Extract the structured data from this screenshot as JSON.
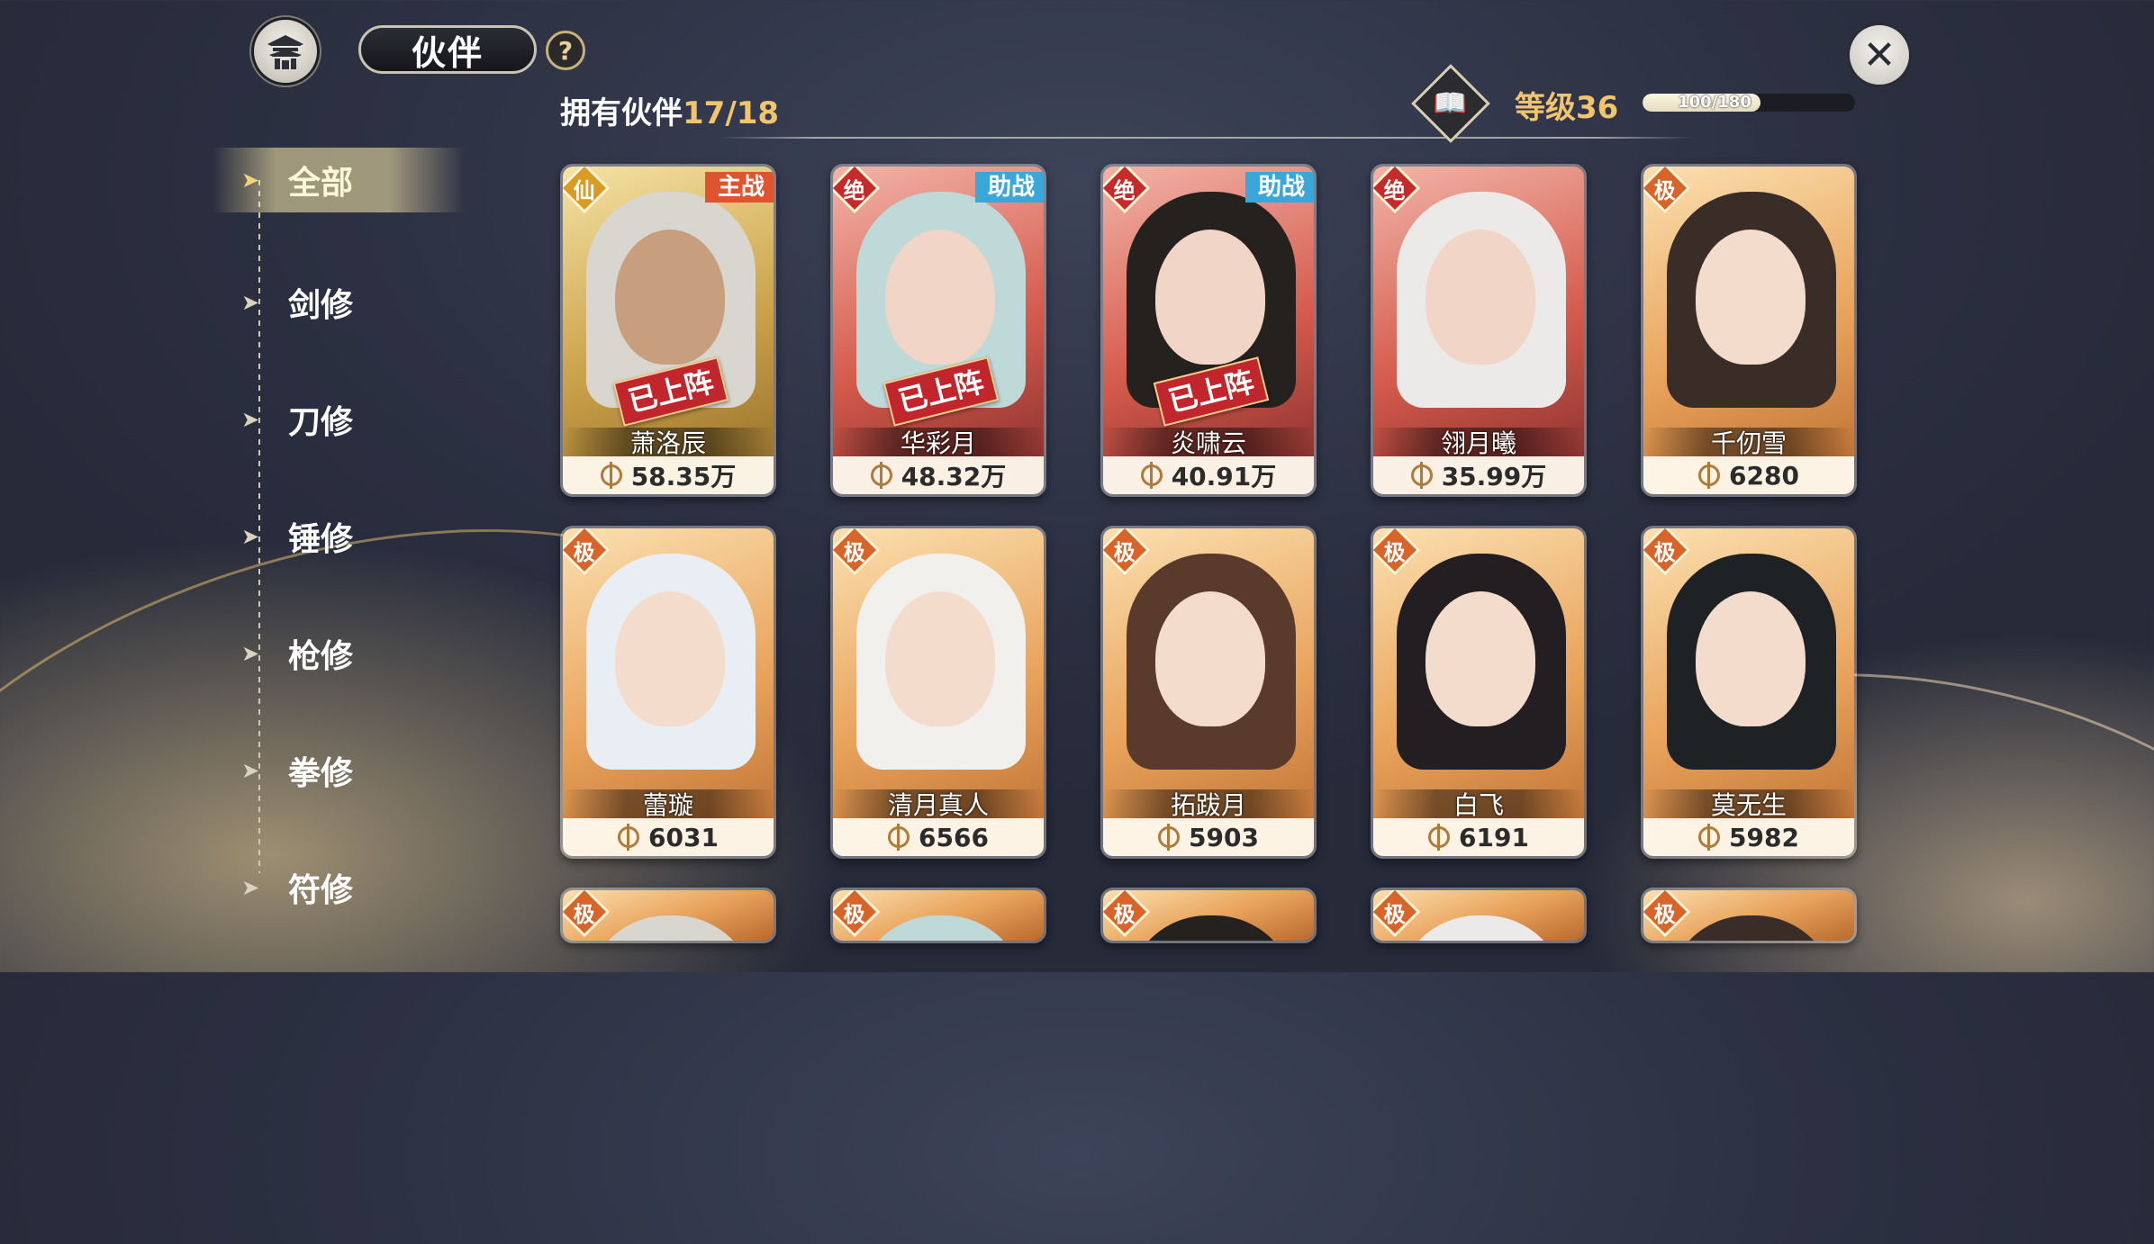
{
  "header": {
    "title": "伙伴",
    "help_label": "?",
    "owned_label": "拥有伙伴",
    "owned_count": "17/18",
    "level_label": "等级36",
    "xp_text": "100/180",
    "xp_fraction": 0.5556
  },
  "sidebar": {
    "items": [
      {
        "label": "全部",
        "active": true
      },
      {
        "label": "剑修",
        "active": false
      },
      {
        "label": "刀修",
        "active": false
      },
      {
        "label": "锤修",
        "active": false
      },
      {
        "label": "枪修",
        "active": false
      },
      {
        "label": "拳修",
        "active": false
      },
      {
        "label": "符修",
        "active": false
      }
    ]
  },
  "cards": [
    {
      "name": "萧洛辰",
      "power": "58.35万",
      "rank": "仙",
      "role": "主战",
      "deployed": "已上阵",
      "theme": "gold"
    },
    {
      "name": "华彩月",
      "power": "48.32万",
      "rank": "绝",
      "role": "助战",
      "deployed": "已上阵",
      "theme": "red"
    },
    {
      "name": "炎啸云",
      "power": "40.91万",
      "rank": "绝",
      "role": "助战",
      "deployed": "已上阵",
      "theme": "red"
    },
    {
      "name": "翎月曦",
      "power": "35.99万",
      "rank": "绝",
      "role": "",
      "deployed": "",
      "theme": "red"
    },
    {
      "name": "千仞雪",
      "power": "6280",
      "rank": "极",
      "role": "",
      "deployed": "",
      "theme": "orange"
    },
    {
      "name": "蕾璇",
      "power": "6031",
      "rank": "极",
      "role": "",
      "deployed": "",
      "theme": "orange"
    },
    {
      "name": "清月真人",
      "power": "6566",
      "rank": "极",
      "role": "",
      "deployed": "",
      "theme": "orange"
    },
    {
      "name": "拓跋月",
      "power": "5903",
      "rank": "极",
      "role": "",
      "deployed": "",
      "theme": "orange"
    },
    {
      "name": "白飞",
      "power": "6191",
      "rank": "极",
      "role": "",
      "deployed": "",
      "theme": "orange"
    },
    {
      "name": "莫无生",
      "power": "5982",
      "rank": "极",
      "role": "",
      "deployed": "",
      "theme": "orange"
    },
    {
      "name": "",
      "power": "",
      "rank": "极",
      "role": "",
      "deployed": "",
      "theme": "orange"
    },
    {
      "name": "",
      "power": "",
      "rank": "极",
      "role": "",
      "deployed": "",
      "theme": "orange"
    },
    {
      "name": "",
      "power": "",
      "rank": "极",
      "role": "",
      "deployed": "",
      "theme": "orange"
    },
    {
      "name": "",
      "power": "",
      "rank": "极",
      "role": "",
      "deployed": "",
      "theme": "orange"
    },
    {
      "name": "",
      "power": "",
      "rank": "极",
      "role": "",
      "deployed": "",
      "theme": "orange"
    }
  ],
  "colors": {
    "accent_gold": "#f2c46e",
    "rank_xian": "#d99b22",
    "rank_jue": "#c72a2a",
    "rank_ji": "#d8642a",
    "role_main": "#e0532f",
    "role_support": "#3aa7d8",
    "deployed_red": "#c0262c"
  }
}
